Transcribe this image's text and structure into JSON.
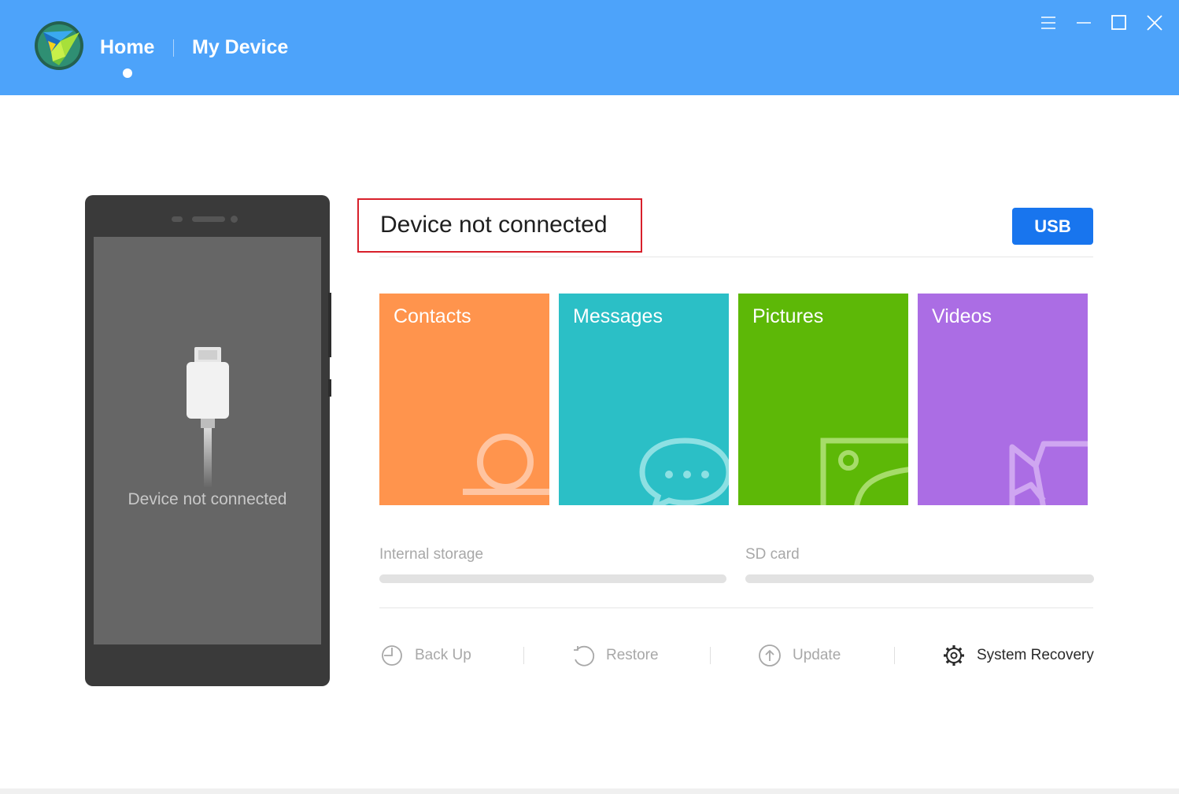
{
  "header": {
    "nav": [
      {
        "label": "Home",
        "active": true
      },
      {
        "label": "My Device",
        "active": false
      }
    ],
    "window_controls": [
      "menu-icon",
      "minimize-icon",
      "maximize-icon",
      "close-icon"
    ]
  },
  "phone": {
    "status_text": "Device not connected"
  },
  "main": {
    "status_title": "Device not connected",
    "connect_button_label": "USB",
    "tiles": [
      {
        "label": "Contacts",
        "color": "#ff944d",
        "icon": "contacts-icon"
      },
      {
        "label": "Messages",
        "color": "#2bbfc6",
        "icon": "messages-icon"
      },
      {
        "label": "Pictures",
        "color": "#5db807",
        "icon": "pictures-icon"
      },
      {
        "label": "Videos",
        "color": "#ab6de4",
        "icon": "videos-icon"
      }
    ],
    "storage": [
      {
        "label": "Internal storage",
        "used_fraction": 0
      },
      {
        "label": "SD card",
        "used_fraction": 0
      }
    ],
    "actions": [
      {
        "label": "Back Up",
        "icon": "backup-icon",
        "enabled": false
      },
      {
        "label": "Restore",
        "icon": "restore-icon",
        "enabled": false
      },
      {
        "label": "Update",
        "icon": "update-icon",
        "enabled": false
      },
      {
        "label": "System Recovery",
        "icon": "gear-icon",
        "enabled": true
      }
    ]
  },
  "colors": {
    "header_bg": "#4da3fa",
    "usb_button": "#1875ee",
    "highlight_border": "#d8202b"
  }
}
